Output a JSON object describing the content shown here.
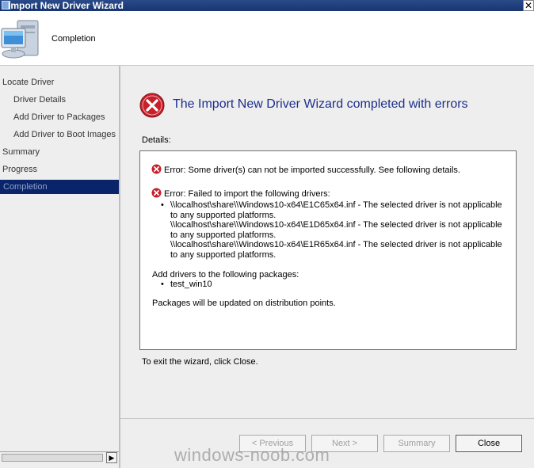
{
  "window": {
    "title": "Import New Driver Wizard"
  },
  "header": {
    "title": "Completion"
  },
  "sidebar": {
    "steps": [
      {
        "label": "Locate Driver",
        "active": false
      },
      {
        "label": "Driver Details",
        "active": false
      },
      {
        "label": "Add Driver to Packages",
        "active": false
      },
      {
        "label": "Add Driver to Boot Images",
        "active": false
      },
      {
        "label": "Summary",
        "active": false
      },
      {
        "label": "Progress",
        "active": false
      },
      {
        "label": "Completion",
        "active": true
      }
    ]
  },
  "main": {
    "result_title": "The Import New Driver Wizard completed with errors",
    "details_label": "Details:",
    "details": {
      "error1": "Error: Some driver(s) can not be imported successfully. See following details.",
      "error2": "Error: Failed to import the following drivers:",
      "drivers": [
        "\\\\localhost\\share\\\\Windows10-x64\\E1C65x64.inf - The selected driver is not applicable to any supported platforms.",
        "\\\\localhost\\share\\\\Windows10-x64\\E1D65x64.inf - The selected driver is not applicable to any supported platforms.",
        "\\\\localhost\\share\\\\Windows10-x64\\E1R65x64.inf - The selected driver is not applicable to any supported platforms."
      ],
      "packages_heading": "Add drivers to the following packages:",
      "packages": [
        "test_win10"
      ],
      "update_note": "Packages will be updated on distribution points."
    },
    "exit_text": "To exit the wizard, click Close."
  },
  "footer": {
    "previous_label": "< Previous",
    "next_label": "Next >",
    "summary_label": "Summary",
    "close_label": "Close"
  },
  "watermark": "windows-noob.com",
  "colors": {
    "title_accent": "#1d2f8c",
    "active_step_bg": "#0a246a",
    "error_red": "#c8202a"
  }
}
